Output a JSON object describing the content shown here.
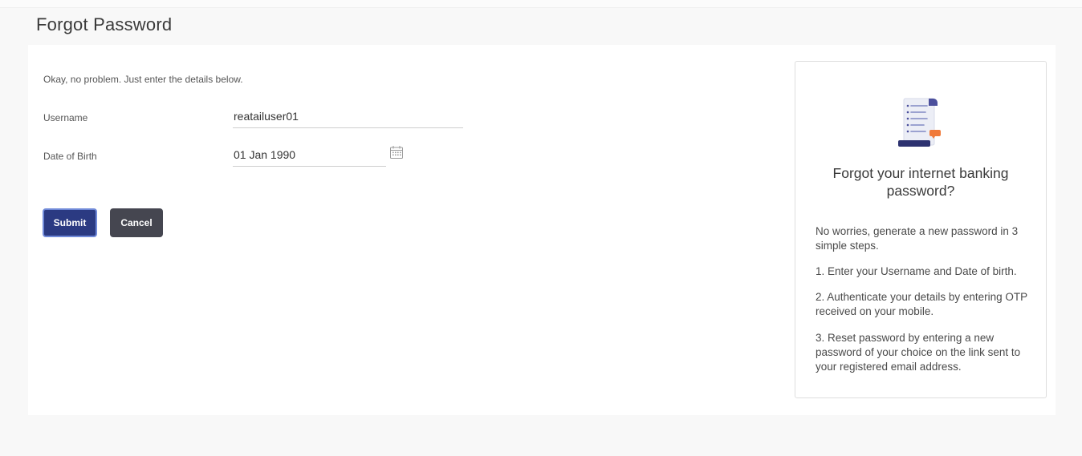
{
  "page": {
    "title": "Forgot Password"
  },
  "form": {
    "intro": "Okay, no problem. Just enter the details below.",
    "username_label": "Username",
    "username_value": "reatailuser01",
    "dob_label": "Date of Birth",
    "dob_value": "01 Jan 1990",
    "submit_label": "Submit",
    "cancel_label": "Cancel"
  },
  "side_panel": {
    "heading": "Forgot your internet banking password?",
    "intro": "No worries, generate a new password in 3 simple steps.",
    "steps": [
      "1. Enter your Username and Date of birth.",
      "2. Authenticate your details by entering OTP received on your mobile.",
      "3. Reset password by entering a new password of your choice on the link sent to your registered email address."
    ],
    "illustration_icon": "document-scroll-icon"
  },
  "icons": {
    "calendar": "calendar-icon"
  },
  "colors": {
    "submit_bg": "#2b3a82",
    "cancel_bg": "#454650",
    "accent_orange": "#f07a3a"
  }
}
